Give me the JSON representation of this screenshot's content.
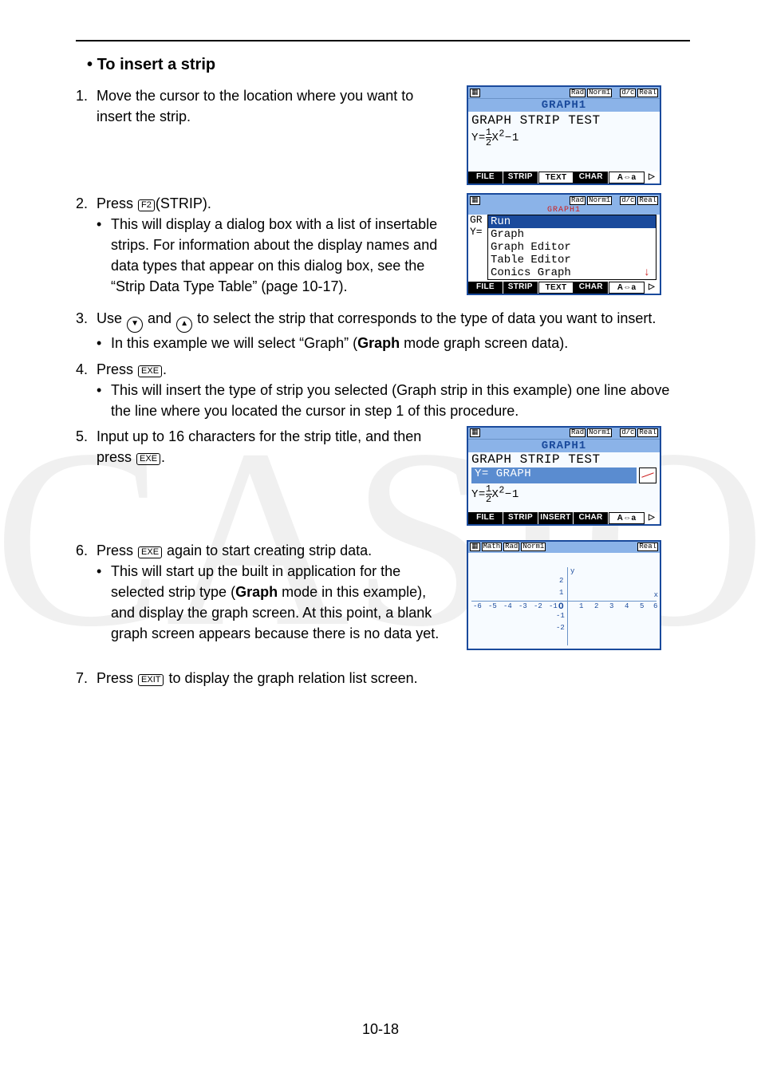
{
  "watermark": "CASIO",
  "page_number": "10-18",
  "section_title": "To insert a strip",
  "bullet_lead": "• ",
  "steps": {
    "s1_num": "1.",
    "s1_text": "Move the cursor to the location where you want to insert the strip.",
    "s2_num": "2.",
    "s2_pre": "Press ",
    "s2_key": "F2",
    "s2_post": "(STRIP).",
    "s2_sub": "This will display a dialog box with a list of insertable strips. For information about the display names and data types that appear on this dialog box, see the “Strip Data Type Table” (page 10-17).",
    "s3_num": "3.",
    "s3_pre": "Use ",
    "s3_key1": "▼",
    "s3_mid": " and ",
    "s3_key2": "▲",
    "s3_post": " to select the strip that corresponds to the type of data you want to insert.",
    "s3_sub_a": "In this example we will select “Graph” (",
    "s3_sub_bold": "Graph",
    "s3_sub_b": " mode graph screen data).",
    "s4_num": "4.",
    "s4_pre": "Press ",
    "s4_key": "EXE",
    "s4_post": ".",
    "s4_sub": "This will insert the type of strip you selected (Graph strip in this example) one line above the line where you located the cursor in step 1 of this procedure.",
    "s5_num": "5.",
    "s5_pre": "Input up to 16 characters for the strip title, and then press ",
    "s5_key": "EXE",
    "s5_post": ".",
    "s6_num": "6.",
    "s6_pre": "Press ",
    "s6_key": "EXE",
    "s6_post": " again to start creating strip data.",
    "s6_sub_a": "This will start up the built in application for the selected strip type (",
    "s6_sub_bold": "Graph",
    "s6_sub_b": " mode in this example), and display the graph screen. At this point, a blank graph screen appears because there is no data yet.",
    "s7_num": "7.",
    "s7_pre": "Press ",
    "s7_key": "EXIT",
    "s7_post": " to display the graph relation list screen."
  },
  "fig1": {
    "status": [
      "Rad",
      "Norm1",
      "d/c",
      "Real"
    ],
    "title": "GRAPH1",
    "line1": "GRAPH STRIP TEST",
    "eq": "Y=½X²−1",
    "menu": [
      "FILE",
      "STRIP",
      "TEXT",
      "CHAR",
      "A⇔a",
      "▷"
    ]
  },
  "fig2": {
    "status": [
      "Rad",
      "Norm1",
      "d/c",
      "Real"
    ],
    "hdr": "GRAPH1",
    "pre1": "GR",
    "pre2": "Y=",
    "items": [
      "Run",
      "Graph",
      "Graph Editor",
      "Table Editor",
      "Conics Graph"
    ],
    "menu": [
      "FILE",
      "STRIP",
      "TEXT",
      "CHAR",
      "A⇔a",
      "▷"
    ]
  },
  "fig3": {
    "status": [
      "Rad",
      "Norm1",
      "d/c",
      "Real"
    ],
    "title": "GRAPH1",
    "line1": "GRAPH STRIP TEST",
    "strip_label": "Y= GRAPH",
    "eq": "Y=½X²−1",
    "menu": [
      "FILE",
      "STRIP",
      "INSERT",
      "CHAR",
      "A⇔a",
      "▷"
    ]
  },
  "fig4": {
    "status": [
      "Math",
      "Rad",
      "Norm1",
      "Real"
    ],
    "xticks": [
      "-6",
      "-5",
      "-4",
      "-3",
      "-2",
      "-1",
      "1",
      "2",
      "3",
      "4",
      "5",
      "6"
    ],
    "yticks": [
      "2",
      "1",
      "-1",
      "-2"
    ],
    "origin": "O",
    "xlabel": "x",
    "ylabel": "y"
  }
}
